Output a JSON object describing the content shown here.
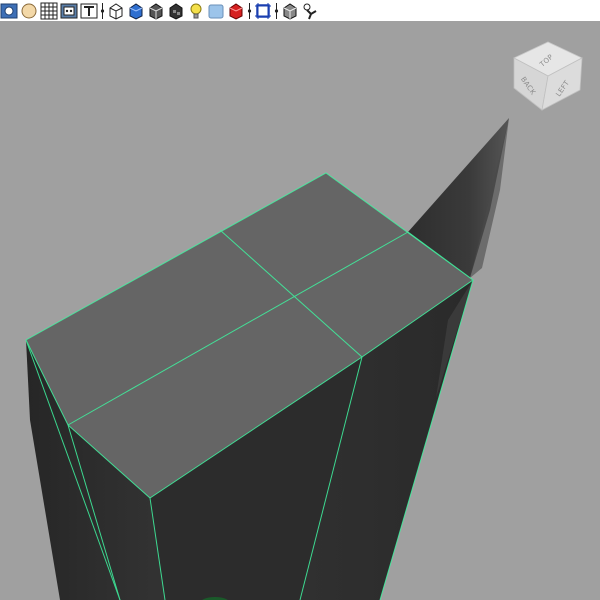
{
  "toolbar": {
    "items": [
      {
        "type": "button",
        "icon": "select-camera-icon"
      },
      {
        "type": "button",
        "icon": "camera-attributes-icon"
      },
      {
        "type": "button",
        "icon": "grid-icon"
      },
      {
        "type": "button",
        "icon": "film-gate-icon"
      },
      {
        "type": "button",
        "icon": "resolution-gate-icon"
      },
      {
        "type": "separator"
      },
      {
        "type": "button",
        "icon": "wireframe-icon"
      },
      {
        "type": "button",
        "icon": "smooth-shade-icon"
      },
      {
        "type": "button",
        "icon": "wireframe-on-shaded-icon"
      },
      {
        "type": "button",
        "icon": "textured-icon"
      },
      {
        "type": "button",
        "icon": "use-all-lights-icon"
      },
      {
        "type": "button",
        "icon": "xray-icon"
      },
      {
        "type": "button",
        "icon": "shadows-icon"
      },
      {
        "type": "separator"
      },
      {
        "type": "button",
        "icon": "isolate-select-icon"
      },
      {
        "type": "separator"
      },
      {
        "type": "button",
        "icon": "xray-joints-icon"
      },
      {
        "type": "button",
        "icon": "xray-active-components-icon"
      }
    ]
  },
  "viewcube": {
    "faces": {
      "top": "TOP",
      "back": "BACK",
      "left": "LEFT"
    }
  },
  "colors": {
    "viewport_background": "#a0a0a0",
    "toolbar_background": "#ffffff",
    "mesh_top_face": "#656565",
    "mesh_side_face": "#2e2e2e",
    "selection_wire": "#3ef5a0"
  }
}
